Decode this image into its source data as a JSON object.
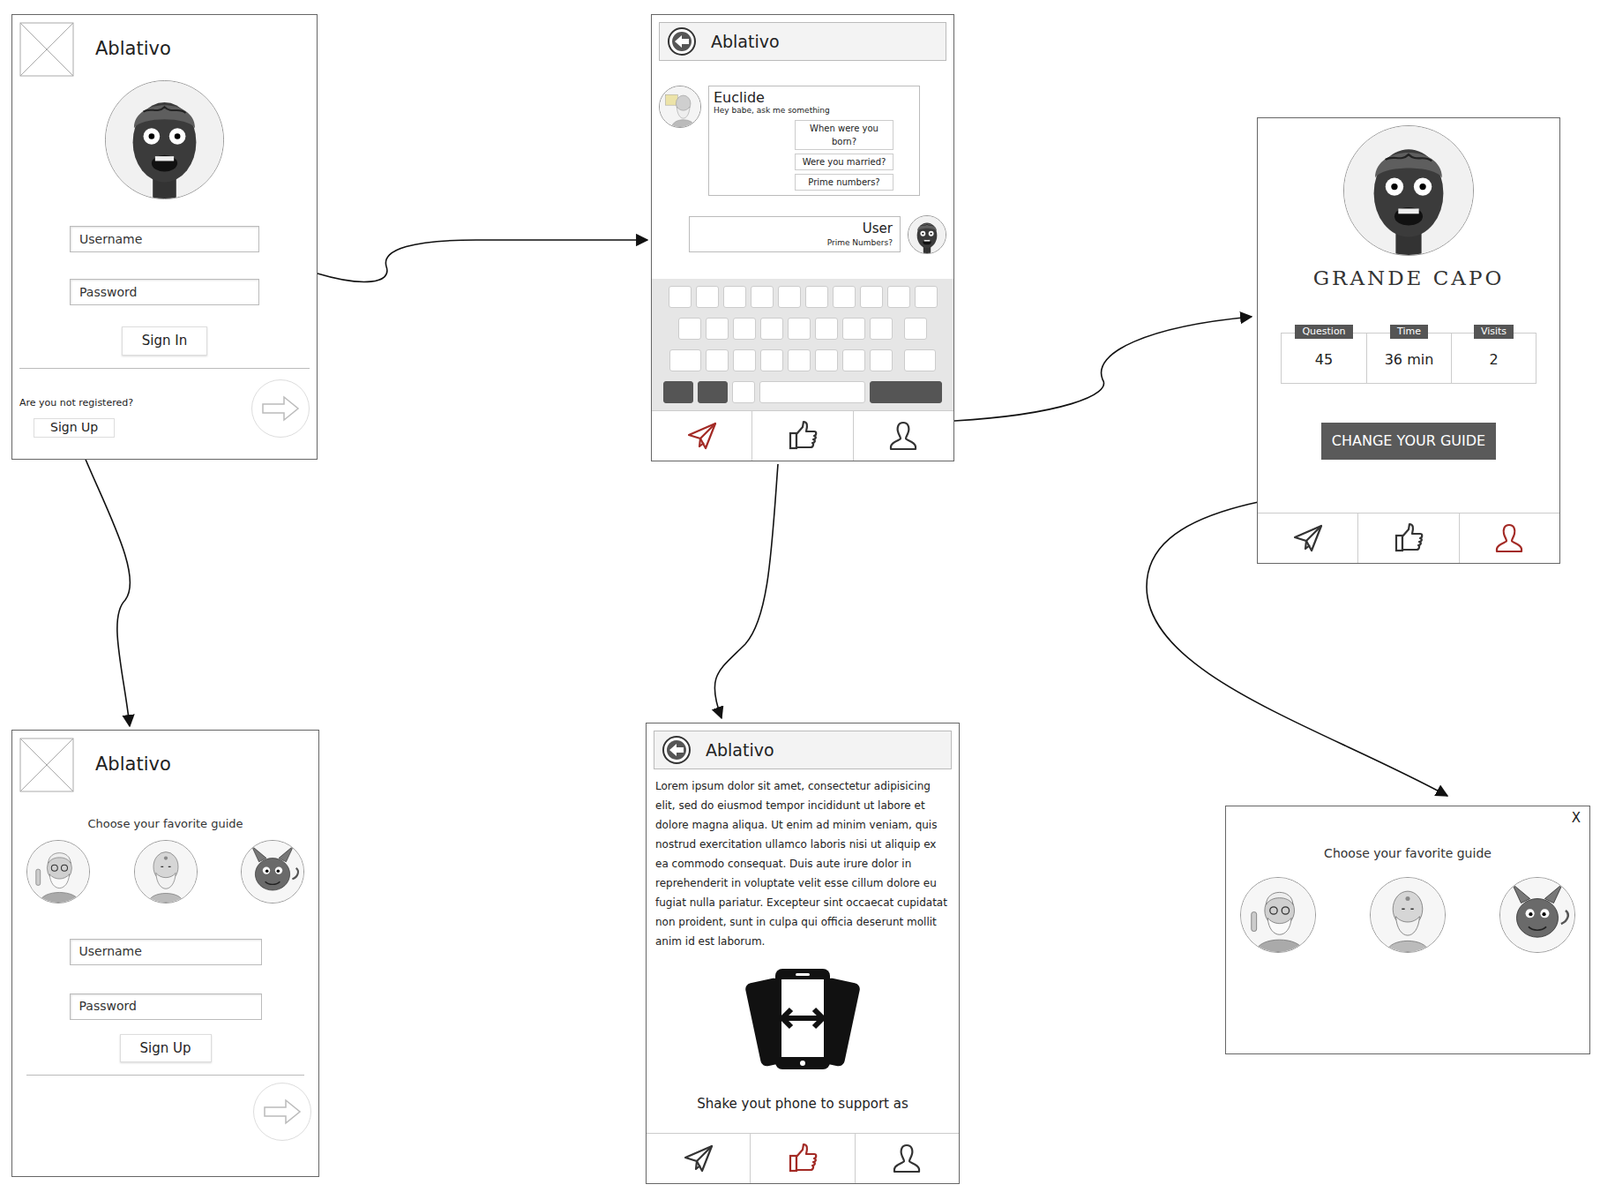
{
  "login": {
    "title": "Ablativo",
    "username": {
      "placeholder": "Username"
    },
    "password": {
      "placeholder": "Password"
    },
    "sign_in": "Sign In",
    "not_registered": "Are you not registered?",
    "sign_up": "Sign Up"
  },
  "signup": {
    "title": "Ablativo",
    "prompt": "Choose your favorite guide",
    "username": {
      "placeholder": "Username"
    },
    "password": {
      "placeholder": "Password"
    },
    "sign_up": "Sign Up"
  },
  "chat": {
    "title": "Ablativo",
    "bot": {
      "name": "Euclide",
      "message": "Hey babe, ask me something",
      "suggestions": [
        "When were you born?",
        "Were you married?",
        "Prime numbers?"
      ]
    },
    "user": {
      "name": "User",
      "message": "Prime Numbers?"
    },
    "tabs": [
      {
        "kind": "send",
        "selected": true
      },
      {
        "kind": "like",
        "selected": false
      },
      {
        "kind": "profile",
        "selected": false
      }
    ]
  },
  "support": {
    "title": "Ablativo",
    "body": "Lorem ipsum dolor sit amet, consectetur adipisicing elit, sed do eiusmod tempor incididunt ut labore et dolore magna aliqua. Ut enim ad minim veniam, quis nostrud exercitation ullamco laboris nisi ut aliquip ex ea commodo consequat. Duis aute irure dolor in reprehenderit in voluptate velit esse cillum dolore eu fugiat nulla pariatur. Excepteur sint occaecat cupidatat non proident, sunt in culpa qui officia deserunt mollit anim id est laborum.",
    "hint": "Shake yout phone to support as",
    "tabs": [
      {
        "kind": "send",
        "selected": false
      },
      {
        "kind": "like",
        "selected": true
      },
      {
        "kind": "profile",
        "selected": false
      }
    ]
  },
  "profile": {
    "name": "GRANDE CAPO",
    "stats": [
      {
        "label": "Question",
        "value": "45"
      },
      {
        "label": "Time",
        "value": "36 min"
      },
      {
        "label": "Visits",
        "value": "2"
      }
    ],
    "button": "CHANGE YOUR GUIDE",
    "tabs": [
      {
        "kind": "send",
        "selected": false
      },
      {
        "kind": "like",
        "selected": false
      },
      {
        "kind": "profile",
        "selected": true
      }
    ]
  },
  "guide_popup": {
    "close": "X",
    "prompt": "Choose your favorite guide"
  }
}
